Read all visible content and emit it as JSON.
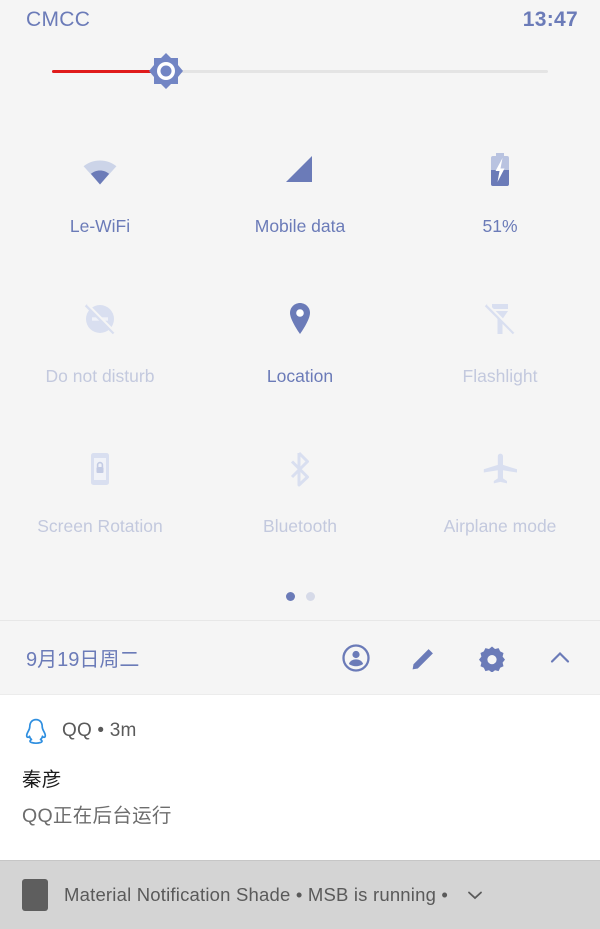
{
  "status_bar": {
    "carrier": "CMCC",
    "clock": "13:47"
  },
  "brightness": {
    "icon": "brightness-sun-icon",
    "value_percent": 23,
    "fill_color": "#e01b1b",
    "track_color": "#e4e4e4",
    "thumb_color": "#7285c4"
  },
  "tiles": [
    [
      {
        "label": "Le-WiFi",
        "icon": "wifi-icon",
        "state": "on"
      },
      {
        "label": "Mobile data",
        "icon": "signal-cellular-icon",
        "state": "on"
      },
      {
        "label": "51%",
        "icon": "battery-charging-icon",
        "state": "on"
      }
    ],
    [
      {
        "label": "Do not disturb",
        "icon": "do-not-disturb-off-icon",
        "state": "off"
      },
      {
        "label": "Location",
        "icon": "location-pin-icon",
        "state": "on"
      },
      {
        "label": "Flashlight",
        "icon": "flashlight-off-icon",
        "state": "off"
      }
    ],
    [
      {
        "label": "Screen Rotation",
        "icon": "screen-rotation-lock-icon",
        "state": "off"
      },
      {
        "label": "Bluetooth",
        "icon": "bluetooth-icon",
        "state": "off"
      },
      {
        "label": "Airplane mode",
        "icon": "airplane-icon",
        "state": "off"
      }
    ]
  ],
  "pager": {
    "pages": 2,
    "active_index": 0
  },
  "date_row": {
    "date": "9月19日周二",
    "actions": [
      {
        "name": "user-account-icon",
        "label": "User"
      },
      {
        "name": "edit-pencil-icon",
        "label": "Edit"
      },
      {
        "name": "settings-gear-icon",
        "label": "Settings"
      },
      {
        "name": "chevron-up-icon",
        "label": "Collapse"
      }
    ]
  },
  "notification": {
    "app_icon": "qq-penguin-icon",
    "app_name": "QQ",
    "separator": "•",
    "time": "3m",
    "meta_line": "QQ • 3m",
    "title": "秦彦",
    "body": "QQ正在后台运行"
  },
  "bottom_bar": {
    "icon": "app-square-icon",
    "text": "Material Notification Shade • MSB is running •",
    "chevron": "chevron-down-icon"
  },
  "colors": {
    "accent": "#6b7bb8",
    "accent_strong": "#5a6db5",
    "inactive": "#ccd2e4",
    "background": "#f5f5f5",
    "notification_bg": "#ffffff",
    "bottom_bar_bg": "#d4d4d4"
  }
}
